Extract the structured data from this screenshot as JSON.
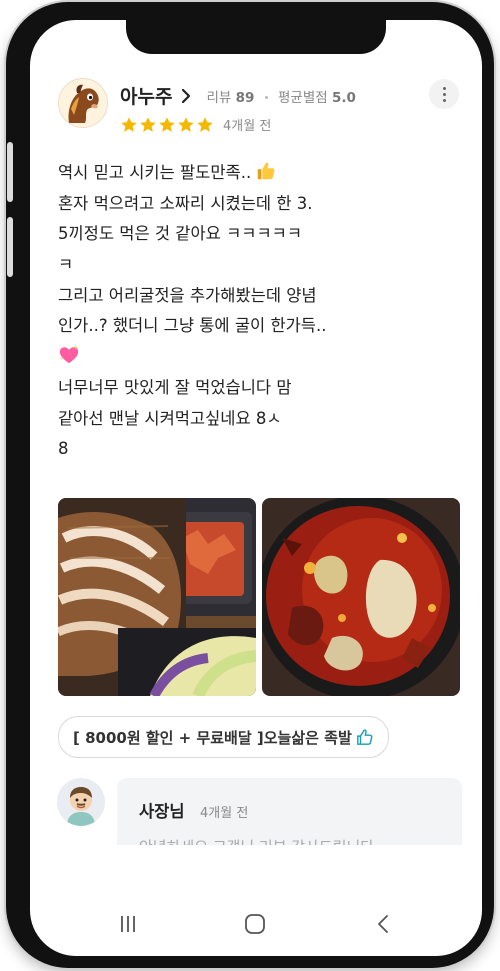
{
  "review": {
    "author_name": "아누주",
    "review_count_label": "리뷰",
    "review_count": "89",
    "avg_rating_label": "평균별점",
    "avg_rating": "5.0",
    "rating": 5,
    "date": "4개월 전",
    "lines": [
      "역시 믿고 시키는 팔도만족..",
      "혼자 먹으려고 소짜리 시켰는데 한 3.",
      "5끼정도 먹은 것 같아요 ㅋㅋㅋㅋㅋ",
      "ㅋ",
      "그리고 어리굴젓을 추가해봤는데 양념",
      "인가..? 했더니 그냥 통에 굴이 한가득..",
      "",
      "너무너무 맛있게 잘 먹었습니다 맘",
      "같아선 맨날 시켜먹고싶네요 8ㅅ",
      "8"
    ],
    "emojis": [
      "thumbs-up-emoji",
      "sparkling-heart-emoji"
    ],
    "photos": [
      "sliced-pork-jokbal-photo",
      "spicy-oyster-stew-photo"
    ],
    "menu_tag": "[ 8000원 할인 + 무료배달 ]오늘삶은 족발"
  },
  "owner_reply": {
    "name": "사장님",
    "date": "4개월 전",
    "preview": "안녕하세요 고객님 리뷰 감사드립니다"
  },
  "nav": {
    "recents_icon": "recents-icon",
    "home_icon": "home-icon",
    "back_icon": "back-icon"
  },
  "colors": {
    "star": "#f5b800",
    "text": "#222222",
    "muted": "#8a8a8a",
    "bubble": "#f3f4f6"
  }
}
